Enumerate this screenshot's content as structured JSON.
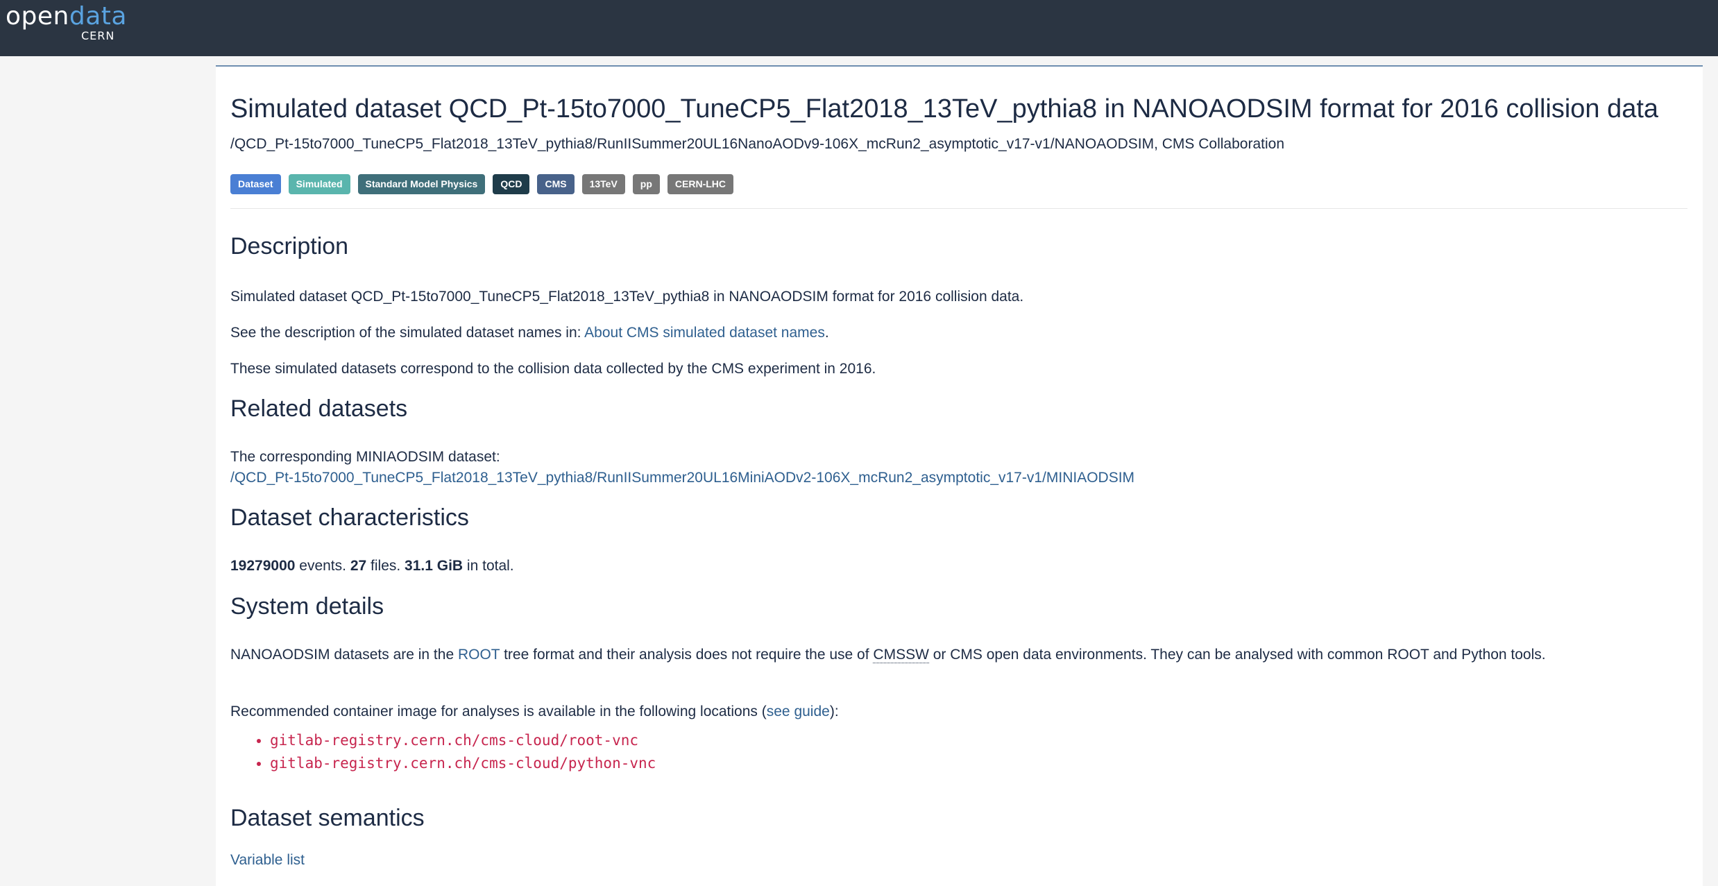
{
  "header": {
    "logo_open": "open",
    "logo_data": "data",
    "logo_sub": "CERN",
    "bg_color": "#2b3542",
    "accent": "#5aa3e0"
  },
  "page": {
    "title": "Simulated dataset QCD_Pt-15to7000_TuneCP5_Flat2018_13TeV_pythia8 in NANOAODSIM format for 2016 collision data",
    "subtitle": "/QCD_Pt-15to7000_TuneCP5_Flat2018_13TeV_pythia8/RunIISummer20UL16NanoAODv9-106X_mcRun2_asymptotic_v17-v1/NANOAODSIM, CMS Collaboration",
    "badges": [
      {
        "label": "Dataset",
        "color": "#4a7fd4"
      },
      {
        "label": "Simulated",
        "color": "#5ab5ad"
      },
      {
        "label": "Standard Model Physics",
        "color": "#3f6f7a"
      },
      {
        "label": "QCD",
        "color": "#1f3c4a"
      },
      {
        "label": "CMS",
        "color": "#48628a"
      },
      {
        "label": "13TeV",
        "color": "#777777"
      },
      {
        "label": "pp",
        "color": "#777777"
      },
      {
        "label": "CERN-LHC",
        "color": "#777777"
      }
    ]
  },
  "description": {
    "heading": "Description",
    "line1": "Simulated dataset QCD_Pt-15to7000_TuneCP5_Flat2018_13TeV_pythia8 in NANOAODSIM format for 2016 collision data.",
    "line2_prefix": "See the description of the simulated dataset names in: ",
    "line2_link": "About CMS simulated dataset names",
    "line2_suffix": ".",
    "line3": "These simulated datasets correspond to the collision data collected by the CMS experiment in 2016."
  },
  "related": {
    "heading": "Related datasets",
    "label": "The corresponding MINIAODSIM dataset:",
    "link": "/QCD_Pt-15to7000_TuneCP5_Flat2018_13TeV_pythia8/RunIISummer20UL16MiniAODv2-106X_mcRun2_asymptotic_v17-v1/MINIAODSIM"
  },
  "characteristics": {
    "heading": "Dataset characteristics",
    "events": "19279000",
    "events_label": " events. ",
    "files": "27",
    "files_label": " files. ",
    "size": "31.1 GiB",
    "size_label": " in total."
  },
  "system": {
    "heading": "System details",
    "p1_a": "NANOAODSIM datasets are in the ",
    "p1_root": "ROOT",
    "p1_b": " tree format and their analysis does not require the use of ",
    "p1_cmssw": "CMSSW",
    "p1_c": " or CMS open data environments. They can be analysed with common ROOT and Python tools.",
    "p2_a": "Recommended container image for analyses is available in the following locations (",
    "p2_link": "see guide",
    "p2_b": "):",
    "images": [
      "gitlab-registry.cern.ch/cms-cloud/root-vnc",
      "gitlab-registry.cern.ch/cms-cloud/python-vnc"
    ]
  },
  "semantics": {
    "heading": "Dataset semantics",
    "link": "Variable list"
  }
}
